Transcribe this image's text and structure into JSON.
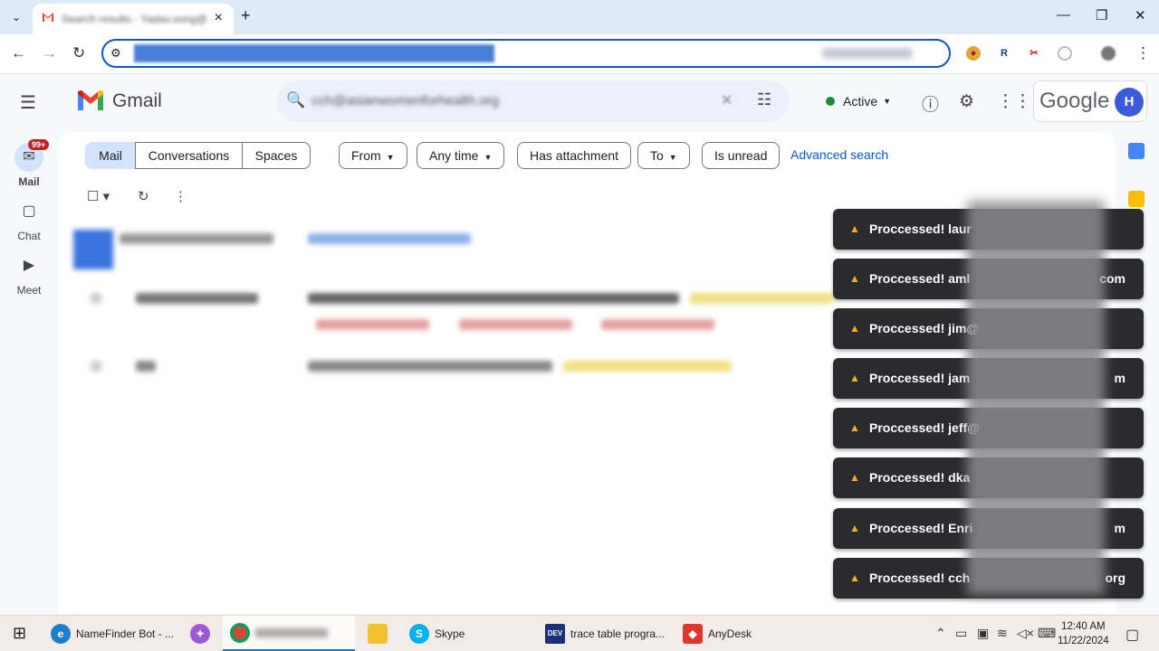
{
  "browser": {
    "tab_title": "Search results - Yadav.song@",
    "new_tab": "+",
    "tab_close": "×",
    "window_controls": {
      "minimize": "—",
      "maximize": "❐",
      "close": "✕"
    }
  },
  "gmail": {
    "app_name": "Gmail",
    "search_query": "cch@asianwomenforhealth.org",
    "status": "Active",
    "google_word": "Google",
    "avatar_initial": "H",
    "rail": [
      {
        "label": "Mail",
        "badge": "99+"
      },
      {
        "label": "Chat"
      },
      {
        "label": "Meet"
      }
    ],
    "scope_tabs": [
      "Mail",
      "Conversations",
      "Spaces"
    ],
    "filters": [
      "From",
      "Any time",
      "Has attachment",
      "To",
      "Is unread"
    ],
    "advanced_search": "Advanced search"
  },
  "notifications": {
    "items": [
      {
        "text": "Proccessed! laur",
        "tail": ""
      },
      {
        "text": "Proccessed! aml",
        "tail": "com"
      },
      {
        "text": "Proccessed! jim@",
        "tail": ""
      },
      {
        "text": "Proccessed! jam",
        "tail": "m"
      },
      {
        "text": "Proccessed! jeff@",
        "tail": ""
      },
      {
        "text": "Proccessed! dka",
        "tail": ""
      },
      {
        "text": "Proccessed! Enri",
        "tail": "m"
      },
      {
        "text": "Proccessed! cch",
        "tail": "org"
      }
    ]
  },
  "taskbar": {
    "items": [
      "NameFinder Bot - ...",
      "",
      "Skype",
      "trace table progra...",
      "AnyDesk"
    ],
    "time": "12:40 AM",
    "date": "11/22/2024"
  },
  "colors": {
    "accent": "#0b57d0",
    "toast_bg": "#2b2b2f",
    "chip_selected": "#d3e3fd"
  }
}
